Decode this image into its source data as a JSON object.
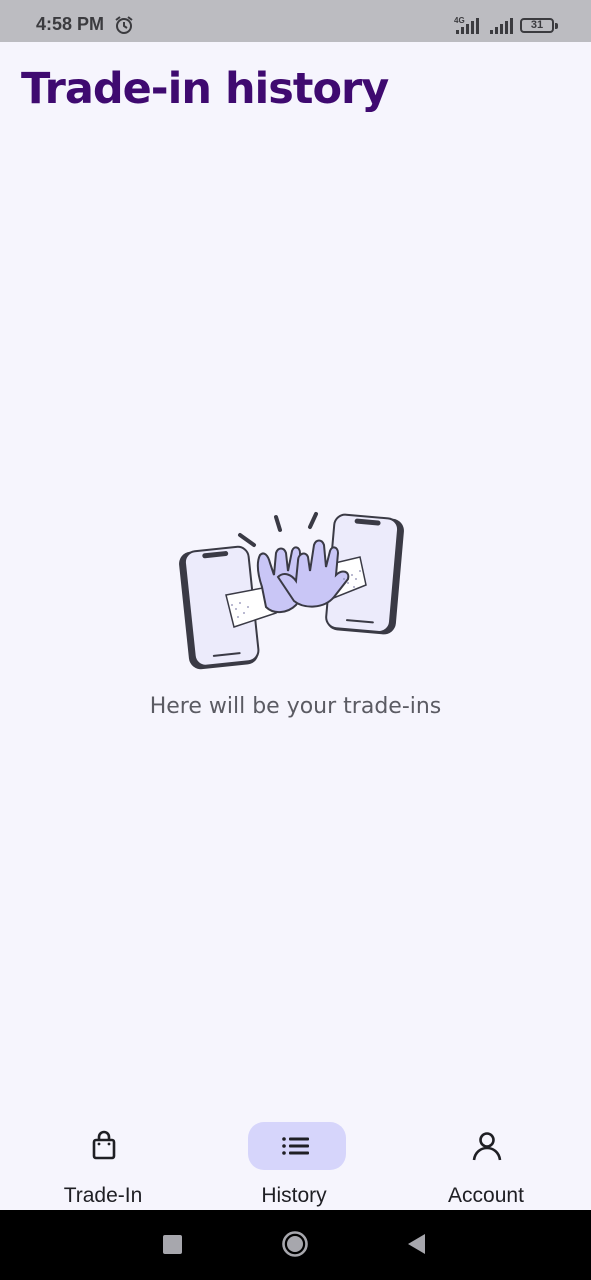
{
  "status_bar": {
    "time": "4:58 PM",
    "network": "4G",
    "battery": "31",
    "icons": [
      "alarm-icon",
      "signal-icon",
      "signal-icon",
      "battery-icon"
    ]
  },
  "page": {
    "title": "Trade-in history"
  },
  "empty_state": {
    "illustration": "high-five-phones-illustration",
    "message": "Here will be your trade-ins"
  },
  "bottom_nav": {
    "items": [
      {
        "label": "Trade-In",
        "icon": "shopping-bag-icon",
        "active": false
      },
      {
        "label": "History",
        "icon": "list-icon",
        "active": true
      },
      {
        "label": "Account",
        "icon": "person-icon",
        "active": false
      }
    ]
  },
  "system_nav": {
    "buttons": [
      "recents-square-icon",
      "home-circle-icon",
      "back-triangle-icon"
    ]
  },
  "colors": {
    "background": "#f6f5fd",
    "title": "#3f0a70",
    "active_pill": "#d6d5fb",
    "illustration_fill": "#c9c6f6"
  }
}
